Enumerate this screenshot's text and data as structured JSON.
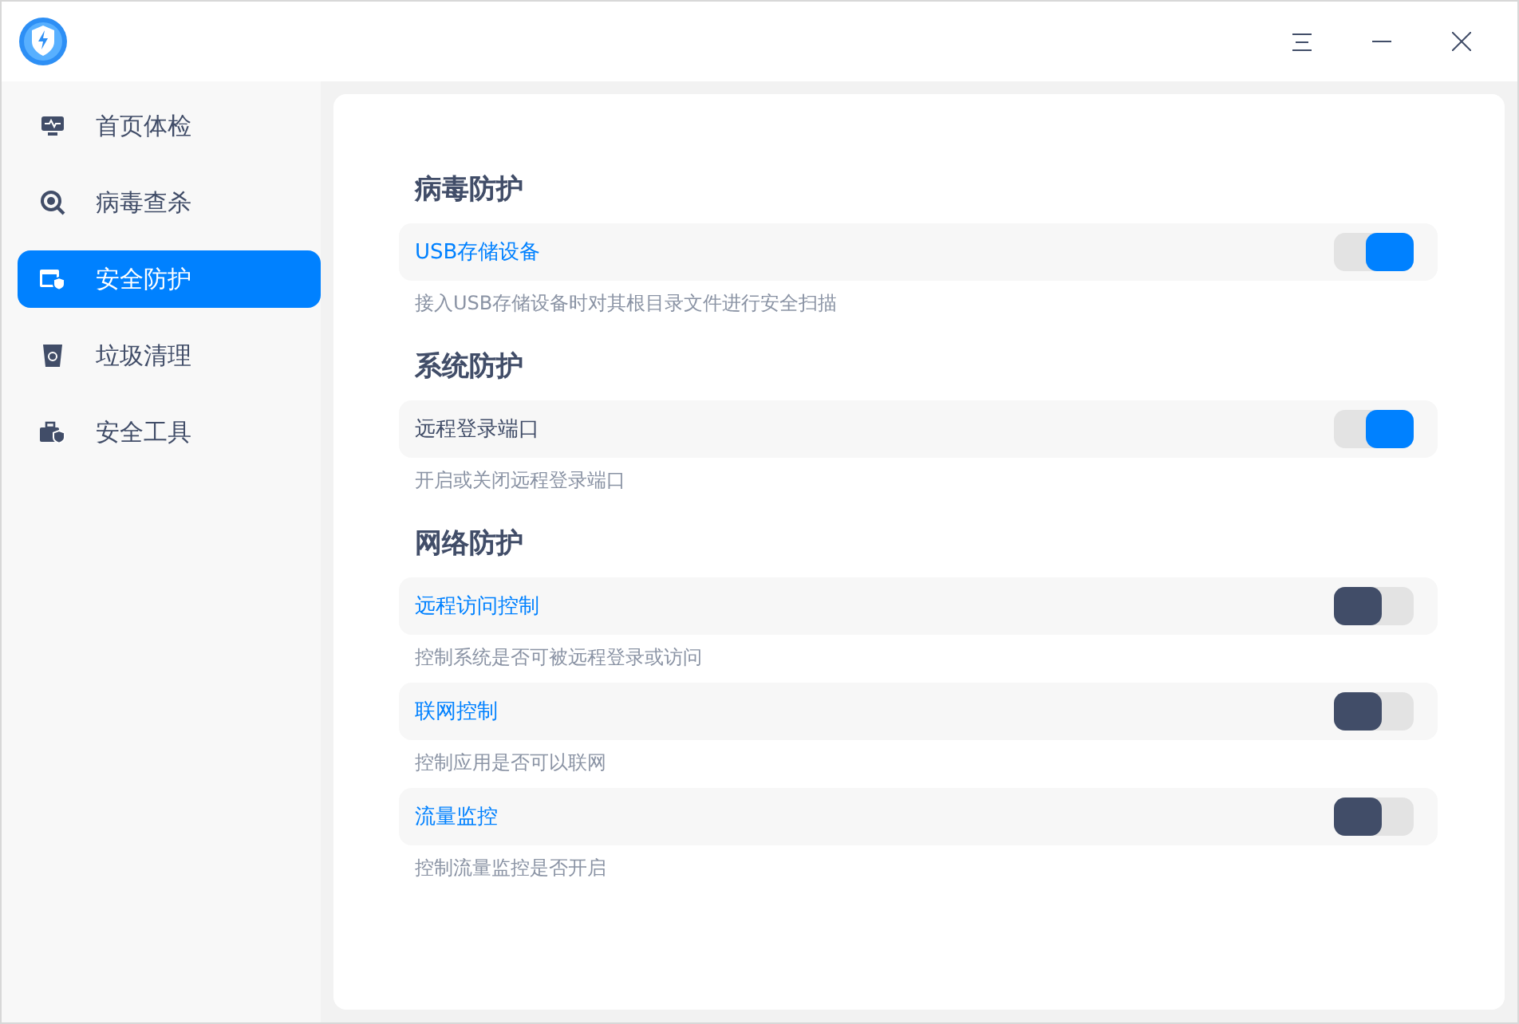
{
  "sidebar": {
    "items": [
      {
        "label": "首页体检",
        "selected": false
      },
      {
        "label": "病毒查杀",
        "selected": false
      },
      {
        "label": "安全防护",
        "selected": true
      },
      {
        "label": "垃圾清理",
        "selected": false
      },
      {
        "label": "安全工具",
        "selected": false
      }
    ]
  },
  "sections": [
    {
      "title": "病毒防护",
      "settings": [
        {
          "label": "USB存储设备",
          "highlighted": true,
          "on": true,
          "description": "接入USB存储设备时对其根目录文件进行安全扫描"
        }
      ]
    },
    {
      "title": "系统防护",
      "settings": [
        {
          "label": "远程登录端口",
          "highlighted": false,
          "on": true,
          "description": "开启或关闭远程登录端口"
        }
      ]
    },
    {
      "title": "网络防护",
      "settings": [
        {
          "label": "远程访问控制",
          "highlighted": true,
          "on": false,
          "description": "控制系统是否可被远程登录或访问"
        },
        {
          "label": "联网控制",
          "highlighted": true,
          "on": false,
          "description": "控制应用是否可以联网"
        },
        {
          "label": "流量监控",
          "highlighted": true,
          "on": false,
          "description": "控制流量监控是否开启"
        }
      ]
    }
  ]
}
